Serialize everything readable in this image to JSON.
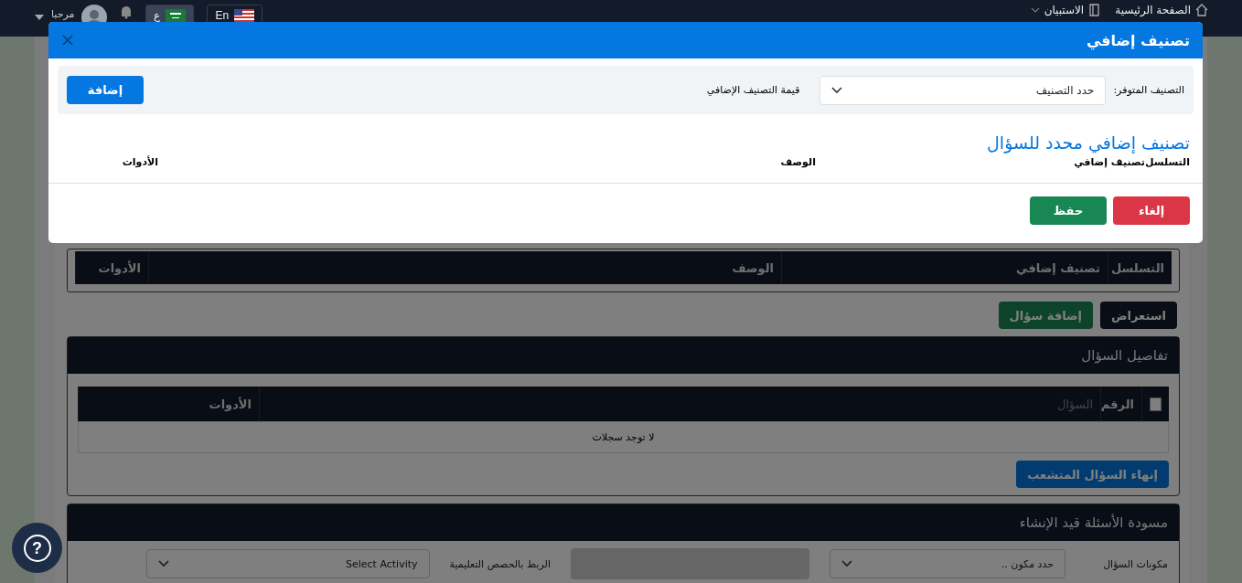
{
  "navbar": {
    "breadcrumbs": [
      {
        "label": "الصفحة الرئيسية",
        "kind": "home"
      },
      {
        "label": "الاستبيان",
        "kind": "survey"
      }
    ],
    "languages": [
      {
        "label": "En",
        "kind": "us",
        "selected": false
      },
      {
        "label": "ع",
        "kind": "sa",
        "selected": true
      }
    ],
    "greeting": "مرحبا"
  },
  "page": {
    "classification_table": {
      "columns": [
        "التسلسل",
        "تصنيف إضافي",
        "الوصف",
        "الأدوات"
      ]
    },
    "buttons": [
      {
        "label": "استعراض",
        "kind": "dark"
      },
      {
        "label": "إضافة سؤال",
        "kind": "success"
      }
    ],
    "question_details": {
      "title": "تفاصيل السؤال",
      "columns": [
        "الرقم",
        "السؤال",
        "الأدوات"
      ],
      "checked": false,
      "empty_text": "لا توجد سجلات",
      "finish_button": "إنهاء السؤال المتشعب"
    },
    "drafts": {
      "title": "مسودة الأسئلة قيد الإنشاء",
      "controls": [
        {
          "kind": "label",
          "text": "مكونات السؤال"
        },
        {
          "kind": "select",
          "value": "حدد مكون .."
        },
        {
          "kind": "input",
          "disabled": true
        },
        {
          "kind": "label",
          "text": "الربط بالحصص التعليمية"
        },
        {
          "kind": "select",
          "value": "Select Activity"
        }
      ]
    }
  },
  "modal": {
    "title": "تصنيف إضافي",
    "filter_label": "التصنيف المتوفر:",
    "select_value": "حدد التصنيف",
    "value_label": "قيمة التصنيف الإضافي",
    "add_button": "إضافة",
    "section_title": "تصنيف إضافي محدد للسؤال",
    "columns": [
      "التسلسل",
      "تصنيف إضافي",
      "الوصف",
      "الأدوات"
    ],
    "buttons": [
      {
        "label": "إلغاء",
        "kind": "danger"
      },
      {
        "label": "حفظ",
        "kind": "success"
      }
    ]
  },
  "help_button": {
    "label": "?"
  }
}
